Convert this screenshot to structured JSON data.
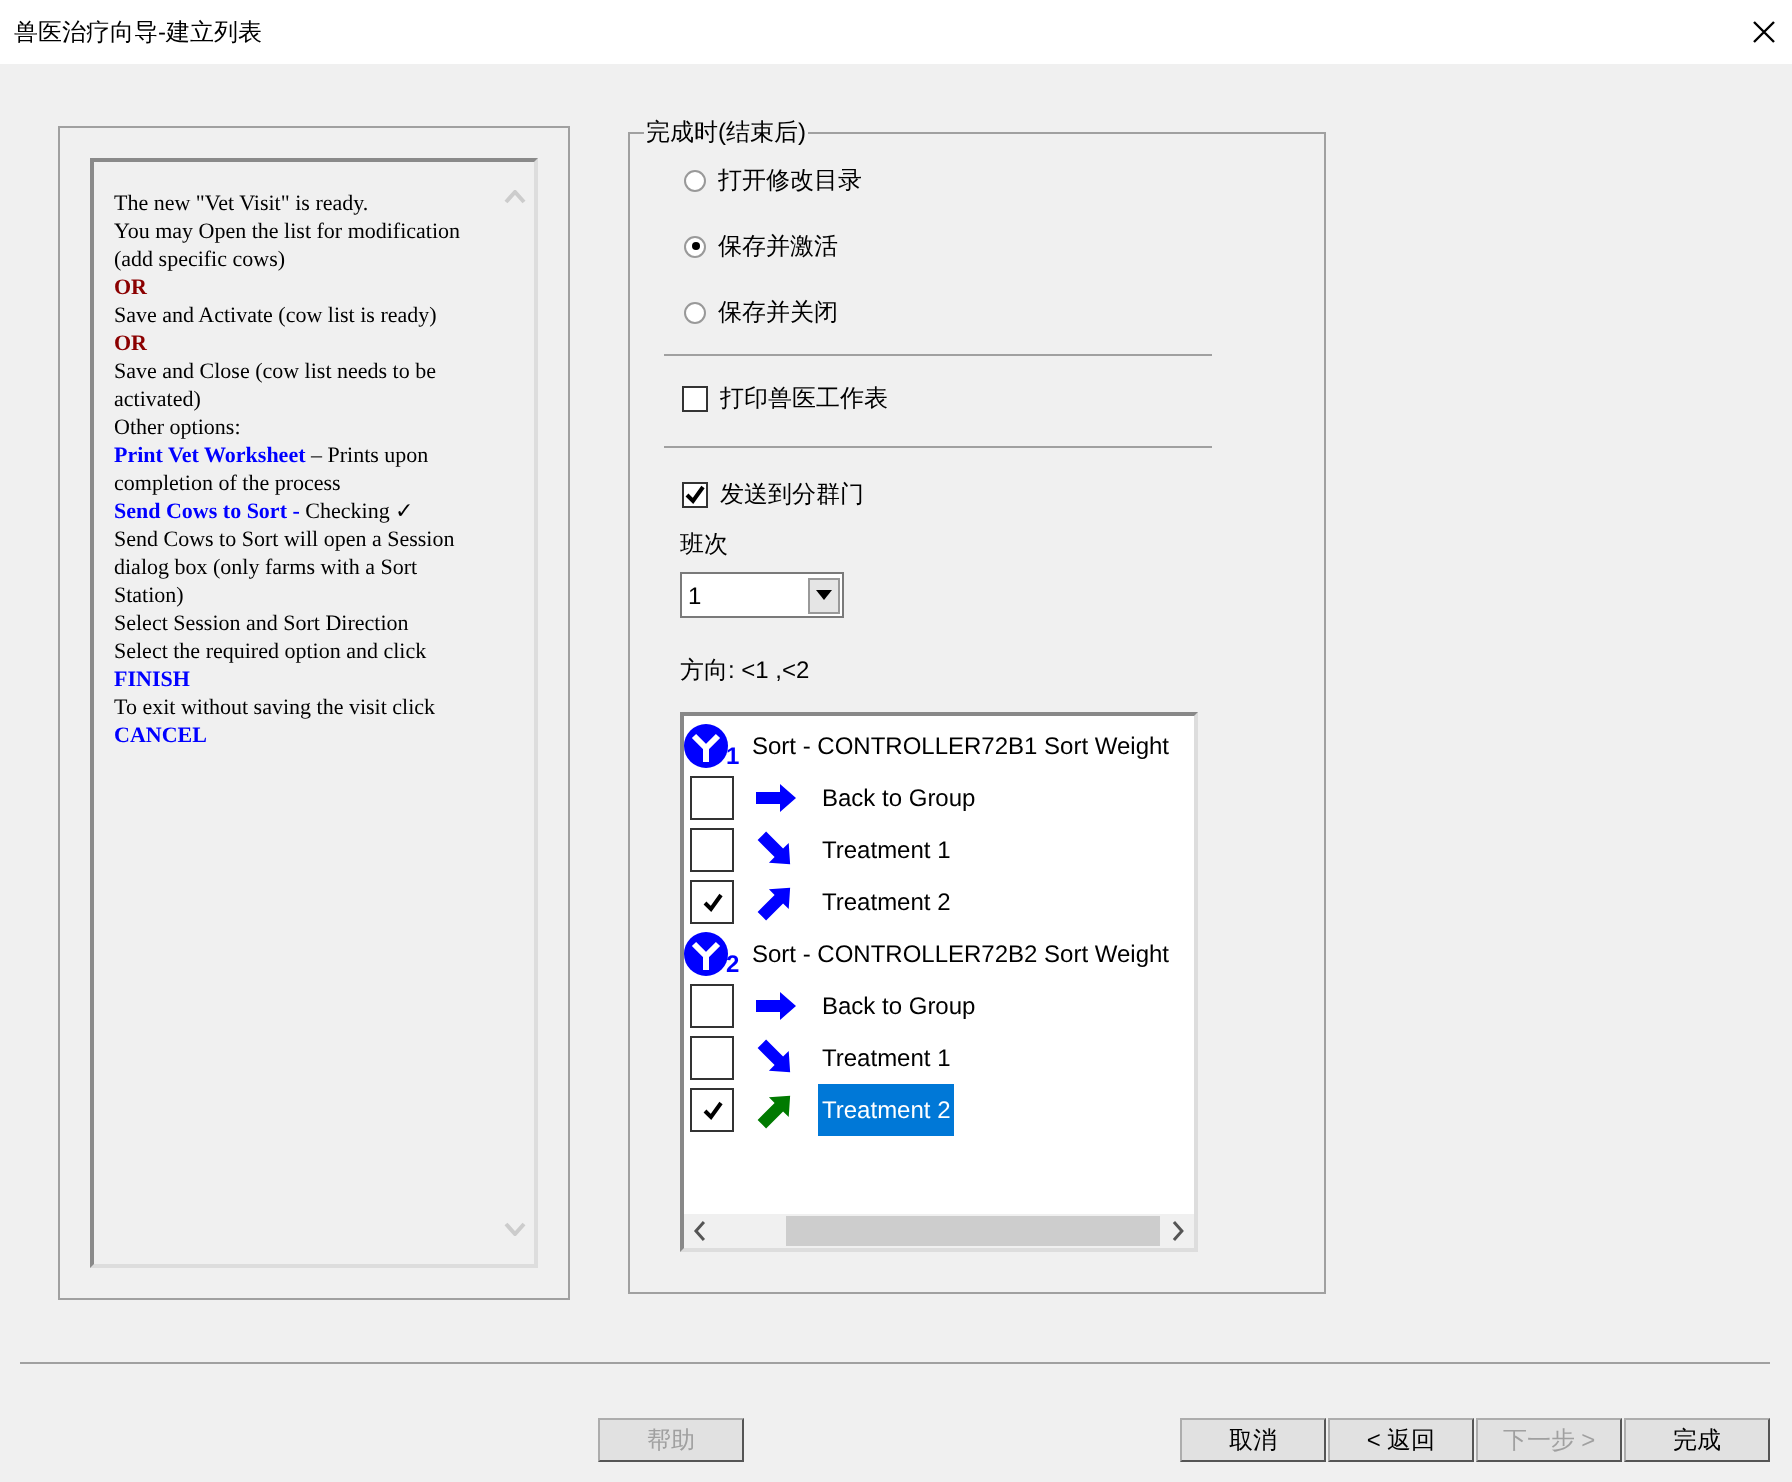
{
  "window": {
    "title": "兽医治疗向导-建立列表"
  },
  "help": {
    "lines": [
      {
        "kind": "text",
        "text": "The new \"Vet Visit\" is ready."
      },
      {
        "kind": "text",
        "text": "You may Open the list for modification (add specific cows)"
      },
      {
        "kind": "or",
        "text": "OR"
      },
      {
        "kind": "text",
        "text": "Save and Activate (cow list is ready)"
      },
      {
        "kind": "or",
        "text": "OR"
      },
      {
        "kind": "text",
        "text": "Save and Close (cow list needs to be activated)"
      },
      {
        "kind": "text",
        "text": "Other options:"
      },
      {
        "kind": "link",
        "text": "Print Vet Worksheet",
        "rest": " – Prints upon completion of the process"
      },
      {
        "kind": "link",
        "text": "Send Cows to Sort -",
        "rest": " Checking ✓"
      },
      {
        "kind": "text",
        "text": "Send Cows to Sort will open a Session dialog box (only farms with a Sort Station)"
      },
      {
        "kind": "text",
        "text": "Select Session and Sort Direction"
      },
      {
        "kind": "text",
        "text": "Select the required option and click"
      },
      {
        "kind": "link",
        "text": "FINISH"
      },
      {
        "kind": "text",
        "text": "To exit without saving the visit click"
      },
      {
        "kind": "link",
        "text": "CANCEL"
      }
    ]
  },
  "options": {
    "legend": "完成时(结束后)",
    "radios": [
      {
        "label": "打开修改目录",
        "selected": false
      },
      {
        "label": "保存并激活",
        "selected": true
      },
      {
        "label": "保存并关闭",
        "selected": false
      }
    ],
    "print_worksheet": {
      "label": "打印兽医工作表",
      "checked": false
    },
    "send_to_sort": {
      "label": "发送到分群门",
      "checked": true
    },
    "shift": {
      "label": "班次",
      "value": "1"
    },
    "direction": "方向: <1 ,<2",
    "sort_tree": [
      {
        "number": "1",
        "label": "Sort - CONTROLLER72B1 Sort Weight",
        "children": [
          {
            "label": "Back to Group",
            "checked": false,
            "selected": false,
            "kind": "right",
            "color": "#0000ff"
          },
          {
            "label": "Treatment 1",
            "checked": false,
            "selected": false,
            "kind": "down-right",
            "color": "#0000ff"
          },
          {
            "label": "Treatment 2",
            "checked": true,
            "selected": false,
            "kind": "up-right",
            "color": "#0000ff"
          }
        ]
      },
      {
        "number": "2",
        "label": "Sort - CONTROLLER72B2 Sort Weight",
        "children": [
          {
            "label": "Back to Group",
            "checked": false,
            "selected": false,
            "kind": "right",
            "color": "#0000ff"
          },
          {
            "label": "Treatment 1",
            "checked": false,
            "selected": false,
            "kind": "down-right",
            "color": "#0000ff"
          },
          {
            "label": "Treatment 2",
            "checked": true,
            "selected": true,
            "kind": "up-right",
            "color": "#007a00"
          }
        ]
      }
    ]
  },
  "buttons": [
    {
      "label": "帮助",
      "disabled": true
    },
    {
      "label": "取消",
      "disabled": false
    },
    {
      "label": "< 返回",
      "disabled": false
    },
    {
      "label": "下一步 >",
      "disabled": true
    },
    {
      "label": "完成",
      "disabled": false
    }
  ]
}
